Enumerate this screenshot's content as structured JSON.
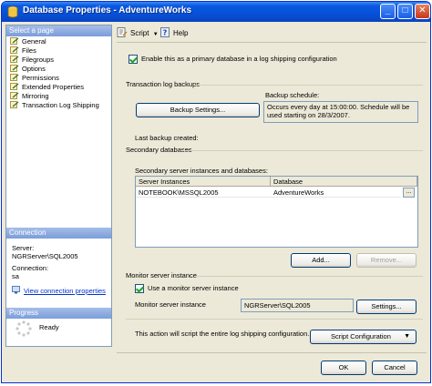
{
  "window": {
    "title": "Database Properties - AdventureWorks",
    "buttons": {
      "minimize": "_",
      "maximize": "□",
      "close": "✕"
    }
  },
  "sidebar": {
    "select_page_header": "Select a page",
    "items": [
      {
        "label": "General",
        "icon": "page-icon"
      },
      {
        "label": "Files",
        "icon": "page-icon"
      },
      {
        "label": "Filegroups",
        "icon": "page-icon"
      },
      {
        "label": "Options",
        "icon": "page-icon"
      },
      {
        "label": "Permissions",
        "icon": "page-icon"
      },
      {
        "label": "Extended Properties",
        "icon": "page-icon"
      },
      {
        "label": "Mirroring",
        "icon": "page-icon"
      },
      {
        "label": "Transaction Log Shipping",
        "icon": "page-icon",
        "selected": true
      }
    ],
    "connection_header": "Connection",
    "server_label": "Server:",
    "server_value": "NGRServer\\SQL2005",
    "connection_label": "Connection:",
    "connection_value": "sa",
    "view_connection_link": "View connection properties",
    "progress_header": "Progress",
    "progress_status": "Ready"
  },
  "toolbar": {
    "script_label": "Script",
    "script_arrow": "▼",
    "help_label": "Help"
  },
  "main": {
    "enable_primary_label": "Enable this as a primary database in a log shipping configuration",
    "transaction_log_backups_label": "Transaction log backups",
    "backup_schedule_label": "Backup schedule:",
    "backup_settings_button": "Backup Settings...",
    "backup_schedule_text": "Occurs every day at 15:00:00. Schedule will be used starting on 28/3/2007.",
    "last_backup_label": "Last backup created:",
    "secondary_databases_label": "Secondary databases",
    "secondary_grid_label": "Secondary server instances and databases:",
    "grid_headers": [
      "Server Instances",
      "Database"
    ],
    "grid_rows": [
      {
        "server": "NOTEBOOK\\MSSQL2005",
        "database": "AdventureWorks",
        "ellipsis": "..."
      }
    ],
    "add_button": "Add...",
    "remove_button": "Remove...",
    "monitor_server_section_label": "Monitor server instance",
    "use_monitor_label": "Use a monitor server instance",
    "monitor_server_instance_label": "Monitor server instance",
    "monitor_server_value": "NGRServer\\SQL2005",
    "monitor_settings_button": "Settings...",
    "script_info_text": "This action will script the entire log shipping configuration.",
    "script_configuration_button": "Script Configuration",
    "script_configuration_arrow": "▼"
  },
  "footer": {
    "ok_button": "OK",
    "cancel_button": "Cancel"
  },
  "colors": {
    "titlebar": "#0651d8",
    "dialog_background": "#ece9d8",
    "pane_header": "#7a9dda",
    "link": "#0033cc"
  }
}
